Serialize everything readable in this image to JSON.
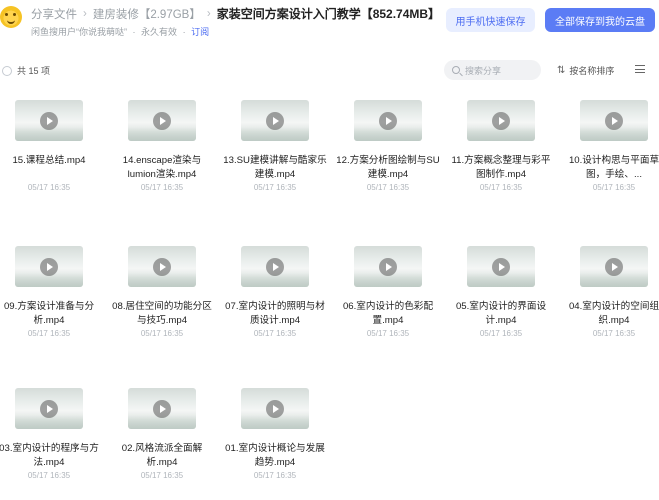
{
  "header": {
    "crumbs": [
      "分享文件",
      "建房装修【2.97GB】"
    ],
    "current": "家装空间方案设计入门教学【852.74MB】",
    "sharer": "闲鱼搜用户“你说我萌哒”",
    "validity": "永久有效",
    "subscribe": "订阅",
    "btn_mobile": "用手机快速保存",
    "btn_save_all": "全部保存到我的云盘"
  },
  "toolbar": {
    "count_label": "共 15 项",
    "search_placeholder": "搜索分享",
    "sort_label": "按名称排序",
    "sort_icon": "sort-icon",
    "view_icon": "list-view-icon"
  },
  "files": [
    {
      "name": "15.课程总结.mp4",
      "date": "05/17 16:35"
    },
    {
      "name": "14.enscape渲染与lumion渲染.mp4",
      "date": "05/17 16:35"
    },
    {
      "name": "13.SU建模讲解与酷家乐建模.mp4",
      "date": "05/17 16:35"
    },
    {
      "name": "12.方案分析图绘制与SU建模.mp4",
      "date": "05/17 16:35"
    },
    {
      "name": "11.方案概念整理与彩平图制作.mp4",
      "date": "05/17 16:35"
    },
    {
      "name": "10.设计构思与平面草图，手绘、...",
      "date": "05/17 16:35"
    },
    {
      "name": "09.方案设计准备与分析.mp4",
      "date": "05/17 16:35"
    },
    {
      "name": "08.居住空间的功能分区与技巧.mp4",
      "date": "05/17 16:35"
    },
    {
      "name": "07.室内设计的照明与材质设计.mp4",
      "date": "05/17 16:35"
    },
    {
      "name": "06.室内设计的色彩配置.mp4",
      "date": "05/17 16:35"
    },
    {
      "name": "05.室内设计的界面设计.mp4",
      "date": "05/17 16:35"
    },
    {
      "name": "04.室内设计的空间组织.mp4",
      "date": "05/17 16:35"
    },
    {
      "name": "03.室内设计的程序与方法.mp4",
      "date": "05/17 16:35"
    },
    {
      "name": "02.风格流派全面解析.mp4",
      "date": "05/17 16:35"
    },
    {
      "name": "01.室内设计概论与发展趋势.mp4",
      "date": "05/17 16:35"
    }
  ],
  "colors": {
    "accent": "#5b7cf5",
    "accent_light": "#e8eeff",
    "link": "#4e6ef2"
  }
}
